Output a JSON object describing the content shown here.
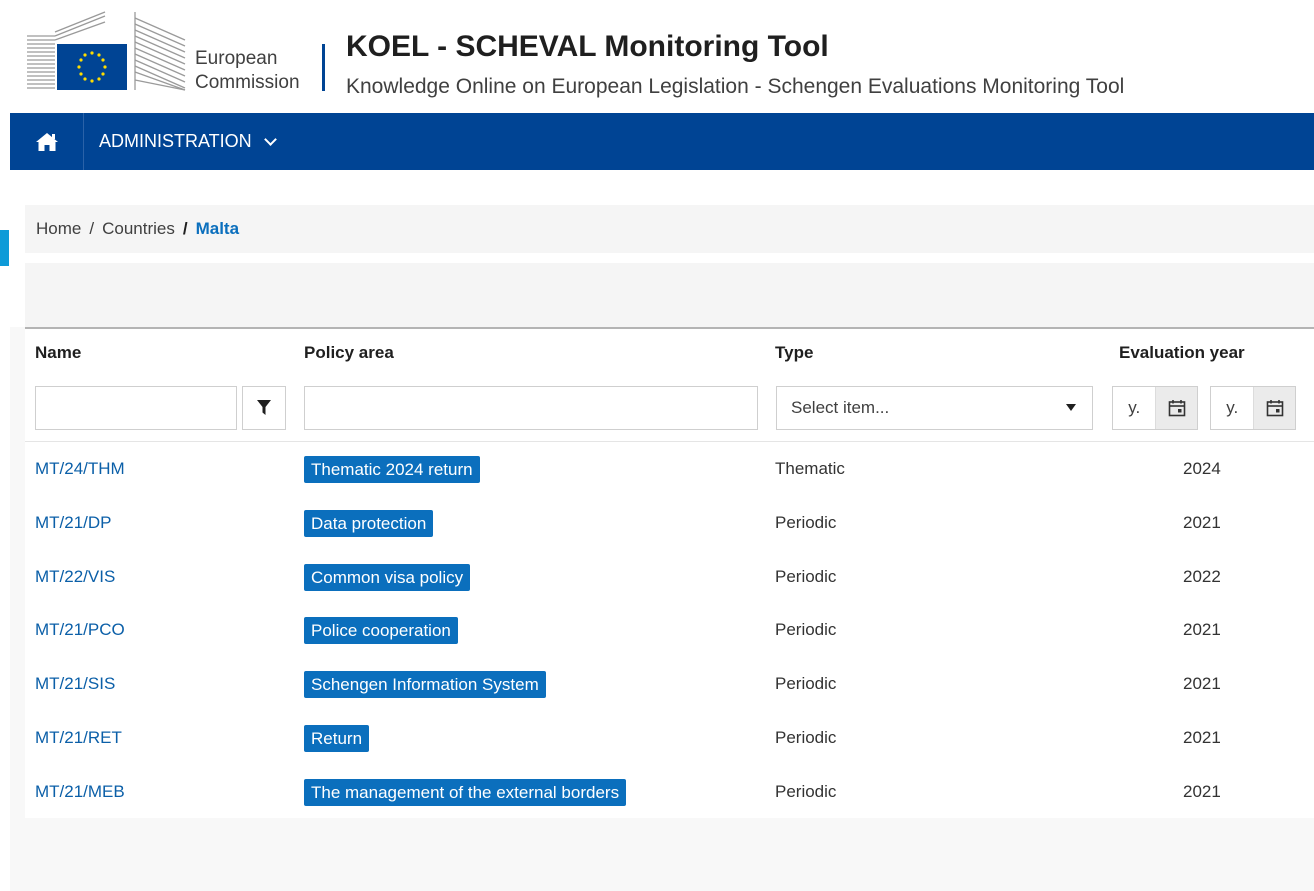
{
  "header": {
    "org_line1": "European",
    "org_line2": "Commission",
    "title": "KOEL - SCHEVAL Monitoring Tool",
    "subtitle": "Knowledge Online on European Legislation - Schengen Evaluations Monitoring Tool"
  },
  "nav": {
    "home_icon": "home-icon",
    "admin_label": "ADMINISTRATION"
  },
  "breadcrumb": {
    "items": [
      "Home",
      "Countries"
    ],
    "current": "Malta",
    "separator": "/"
  },
  "table": {
    "columns": {
      "name": "Name",
      "policy": "Policy area",
      "type": "Type",
      "year": "Evaluation year"
    },
    "filters": {
      "name_value": "",
      "policy_value": "",
      "type_placeholder": "Select item...",
      "year_from_placeholder": "y.",
      "year_to_placeholder": "y."
    },
    "rows": [
      {
        "name": "MT/24/THM",
        "policy": "Thematic 2024 return",
        "type": "Thematic",
        "year": "2024"
      },
      {
        "name": "MT/21/DP",
        "policy": "Data protection",
        "type": "Periodic",
        "year": "2021"
      },
      {
        "name": "MT/22/VIS",
        "policy": "Common visa policy",
        "type": "Periodic",
        "year": "2022"
      },
      {
        "name": "MT/21/PCO",
        "policy": "Police cooperation",
        "type": "Periodic",
        "year": "2021"
      },
      {
        "name": "MT/21/SIS",
        "policy": "Schengen Information System",
        "type": "Periodic",
        "year": "2021"
      },
      {
        "name": "MT/21/RET",
        "policy": "Return",
        "type": "Periodic",
        "year": "2021"
      },
      {
        "name": "MT/21/MEB",
        "policy": "The management of the external borders",
        "type": "Periodic",
        "year": "2021"
      }
    ]
  },
  "colors": {
    "brand_blue": "#004494",
    "link_blue": "#0b5fa8",
    "tag_blue": "#0b6fbd",
    "accent": "#0e9bd8"
  }
}
